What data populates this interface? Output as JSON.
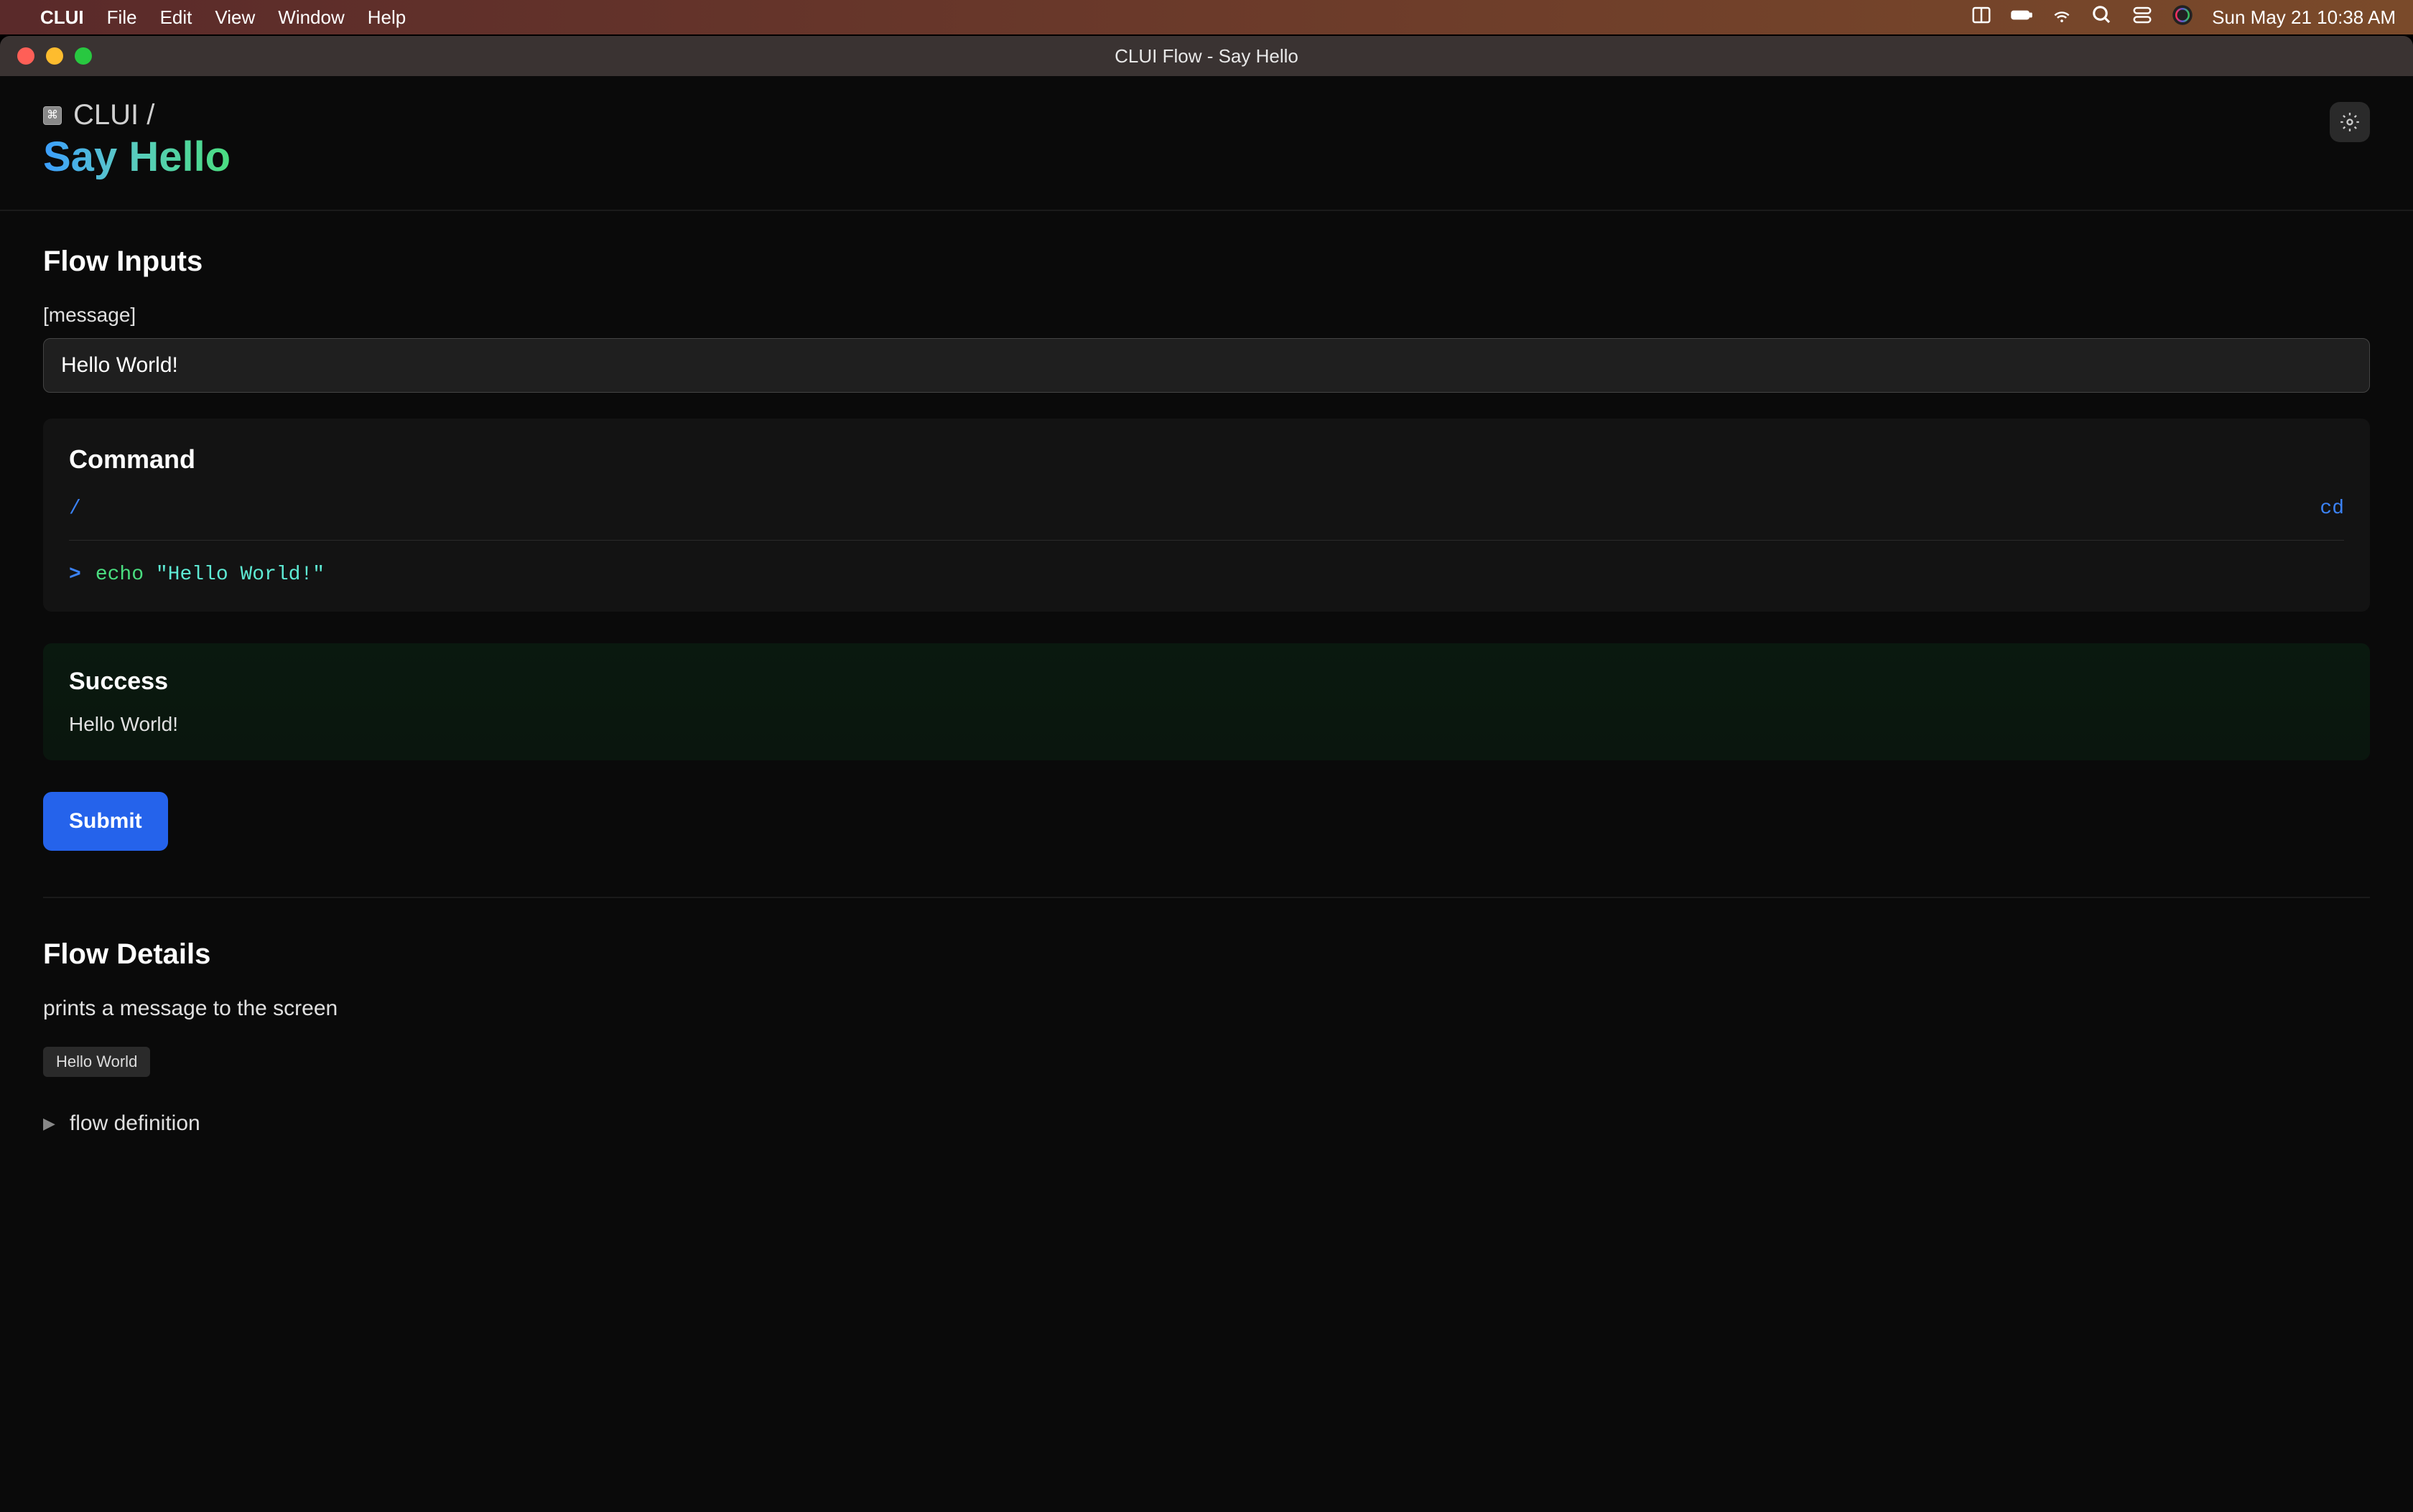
{
  "menubar": {
    "app": "CLUI",
    "items": [
      "File",
      "Edit",
      "View",
      "Window",
      "Help"
    ],
    "datetime": "Sun May 21  10:38 AM"
  },
  "window": {
    "title": "CLUI Flow - Say Hello"
  },
  "breadcrumb": {
    "app_name": "CLUI /"
  },
  "page": {
    "title": "Say Hello"
  },
  "flow_inputs": {
    "heading": "Flow Inputs",
    "fields": [
      {
        "label": "[message]",
        "value": "Hello World!"
      }
    ]
  },
  "command": {
    "heading": "Command",
    "path": "/",
    "cd_label": "cd",
    "prompt": ">",
    "cmd": "echo",
    "arg": "\"Hello World!\""
  },
  "result": {
    "heading": "Success",
    "output": "Hello World!"
  },
  "actions": {
    "submit": "Submit"
  },
  "flow_details": {
    "heading": "Flow Details",
    "description": "prints a message to the screen",
    "tag": "Hello World",
    "disclosure": "flow definition"
  }
}
